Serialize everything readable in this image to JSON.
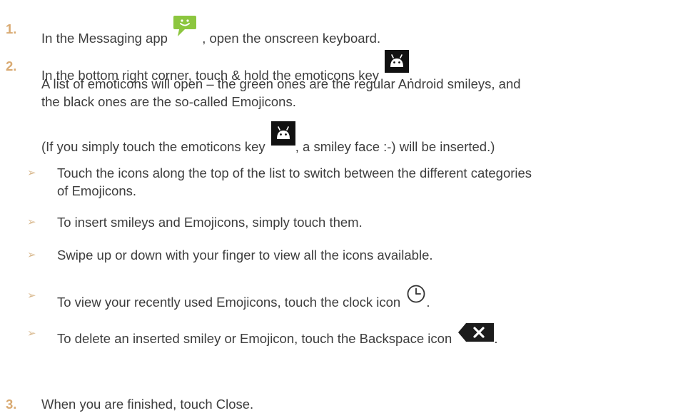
{
  "steps": [
    {
      "number": "1.",
      "text_before": "In the Messaging app",
      "text_after": ", open the onscreen keyboard.",
      "icon": "messaging-app-icon"
    },
    {
      "number": "2.",
      "line1_before": "In the bottom right corner, touch & hold the emoticons key",
      "line1_after": ".",
      "line2": "A list of emoticons will open – the green ones are the regular Android smileys, and",
      "line3": "the black ones are the so-called Emojicons.",
      "note_before": "(If you simply touch the emoticons key",
      "note_after": ", a smiley face :-) will be inserted.)",
      "icon": "emoticons-key-icon"
    },
    {
      "number": "3.",
      "text": "When you are finished, touch Close."
    }
  ],
  "bullets": [
    {
      "line1": "Touch the icons along the top of the list to switch between the different categories",
      "line2": "of Emojicons."
    },
    {
      "text": "To insert smileys and Emojicons, simply touch them."
    },
    {
      "text": "Swipe up or down with your finger to view all the icons available."
    },
    {
      "text_before": "To view your recently used Emojicons, touch the clock icon",
      "text_after": ".",
      "icon": "clock-icon"
    },
    {
      "text_before": "To delete an inserted smiley or Emojicon, touch the Backspace icon",
      "text_after": ".",
      "icon": "backspace-icon"
    }
  ],
  "colors": {
    "step_number": "#d9aa72",
    "bullet_arrow": "#d9b98f",
    "body_text": "#3d3d3d",
    "messaging_icon": "#8cc63f",
    "emoticons_key": "#111111",
    "backspace_key": "#1c1c1c"
  },
  "bullet_glyph": "➢"
}
